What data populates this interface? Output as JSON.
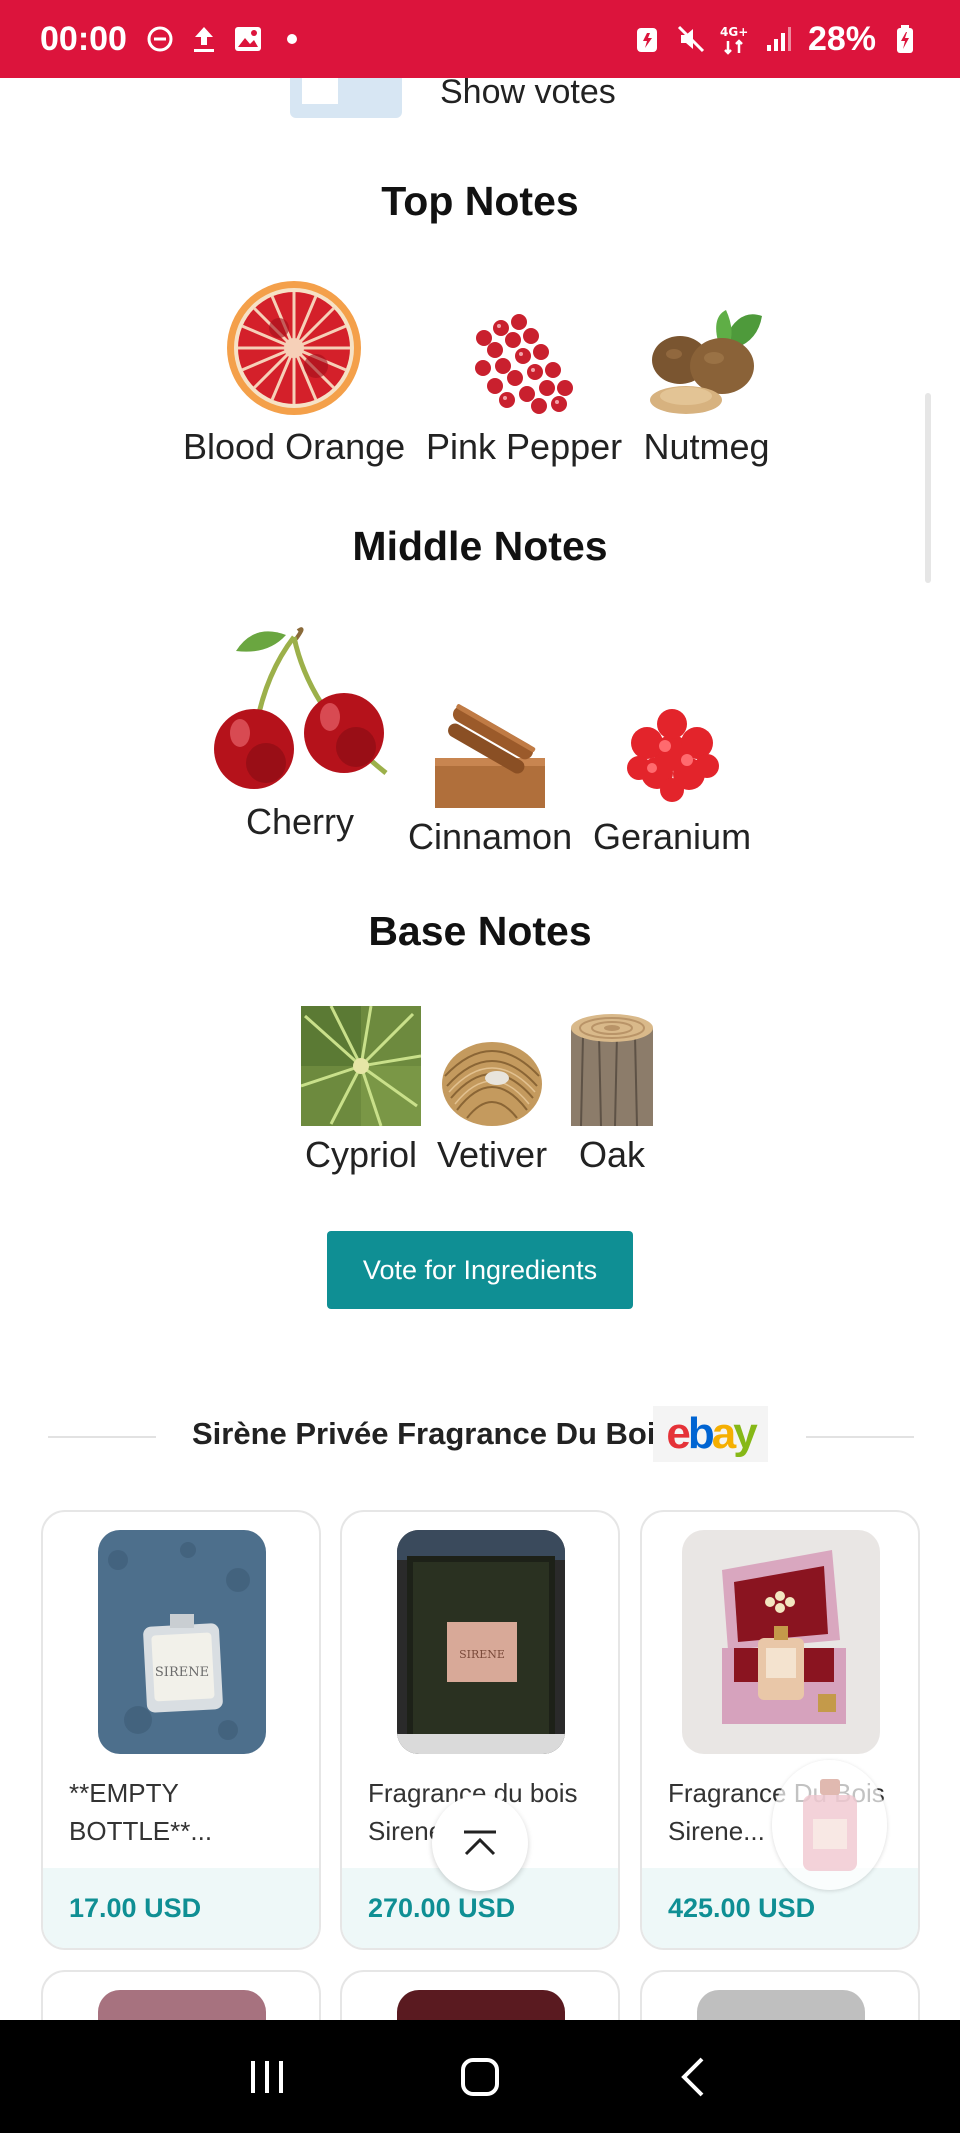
{
  "status_bar": {
    "time": "00:00",
    "battery": "28%",
    "network": "4G+"
  },
  "show_votes": {
    "label": "Show votes"
  },
  "top_notes": {
    "heading": "Top Notes",
    "items": [
      {
        "label": "Blood Orange"
      },
      {
        "label": "Pink Pepper"
      },
      {
        "label": "Nutmeg"
      }
    ]
  },
  "middle_notes": {
    "heading": "Middle Notes",
    "items": [
      {
        "label": "Cherry"
      },
      {
        "label": "Cinnamon"
      },
      {
        "label": "Geranium"
      }
    ]
  },
  "base_notes": {
    "heading": "Base Notes",
    "items": [
      {
        "label": "Cypriol"
      },
      {
        "label": "Vetiver"
      },
      {
        "label": "Oak"
      }
    ]
  },
  "vote_button": {
    "label": "Vote for Ingredients"
  },
  "ebay": {
    "title": "Sirène Privée Fragrance Du Bois",
    "logo_letters": [
      "e",
      "b",
      "a",
      "y"
    ],
    "logo_colors": [
      "#e53238",
      "#0064d2",
      "#f5af02",
      "#86b817"
    ]
  },
  "products": [
    {
      "title": "**EMPTY BOTTLE**...",
      "price": "17.00 USD"
    },
    {
      "title": "Fragrance du bois Sirene New...",
      "price": "270.00 USD"
    },
    {
      "title": "Fragrance Du Bois Sirene...",
      "price": "425.00 USD"
    }
  ],
  "colors": {
    "status_bar": "#dc143c",
    "accent": "#0f8f94"
  }
}
